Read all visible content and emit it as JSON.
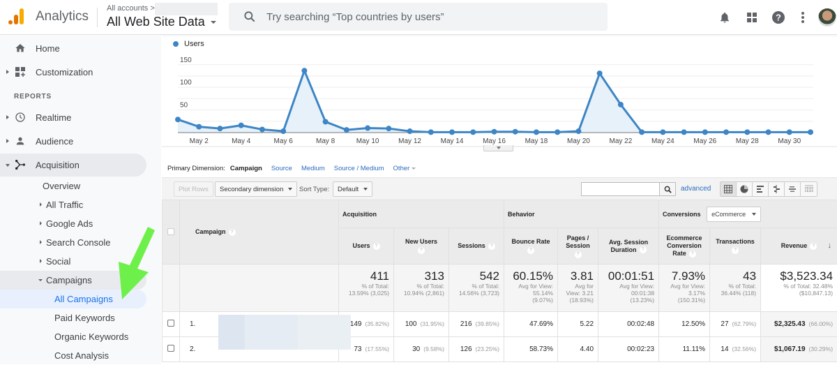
{
  "header": {
    "app_name": "Analytics",
    "account_crumb": "All accounts >",
    "view_name": "All Web Site Data",
    "search_placeholder": "Try searching “Top countries by users”",
    "icons": [
      "notifications-icon",
      "apps-grid-icon",
      "help-icon",
      "more-vert-icon",
      "avatar"
    ]
  },
  "sidebar": {
    "items": [
      {
        "label": "Home",
        "icon": "home-icon"
      },
      {
        "label": "Customization",
        "icon": "customization-icon"
      }
    ],
    "section_label": "REPORTS",
    "reports": [
      {
        "label": "Realtime",
        "icon": "clock-icon"
      },
      {
        "label": "Audience",
        "icon": "person-icon"
      },
      {
        "label": "Acquisition",
        "icon": "acquisition-icon"
      }
    ],
    "acquisition_children": [
      "Overview",
      "All Traffic",
      "Google Ads",
      "Search Console",
      "Social",
      "Campaigns"
    ],
    "campaign_children": [
      "All Campaigns",
      "Paid Keywords",
      "Organic Keywords",
      "Cost Analysis"
    ],
    "selected": "All Campaigns"
  },
  "chart_data": {
    "type": "line",
    "title": "",
    "legend": [
      "Users"
    ],
    "legend_placement": "top-left",
    "series_color": "#3d85c6",
    "x": [
      "May 1",
      "May 2",
      "May 3",
      "May 4",
      "May 5",
      "May 6",
      "May 7",
      "May 8",
      "May 9",
      "May 10",
      "May 11",
      "May 12",
      "May 13",
      "May 14",
      "May 15",
      "May 16",
      "May 17",
      "May 18",
      "May 19",
      "May 20",
      "May 21",
      "May 22",
      "May 23",
      "May 24",
      "May 25",
      "May 26",
      "May 27",
      "May 28",
      "May 29",
      "May 30",
      "May 31"
    ],
    "x_tick_labels": [
      "May 2",
      "May 4",
      "May 6",
      "May 8",
      "May 10",
      "May 12",
      "May 14",
      "May 16",
      "May 18",
      "May 20",
      "May 22",
      "May 24",
      "May 26",
      "May 28",
      "May 30"
    ],
    "series": [
      {
        "name": "Users",
        "values": [
          29,
          13,
          9,
          16,
          7,
          3,
          137,
          24,
          6,
          10,
          9,
          3,
          1,
          1,
          1,
          2,
          2,
          1,
          1,
          3,
          131,
          62,
          1,
          1,
          1,
          1,
          1,
          1,
          1,
          1,
          1
        ]
      }
    ],
    "y_ticks": [
      50,
      100,
      150
    ],
    "ylim": [
      0,
      150
    ],
    "grid": true,
    "area_fill": true
  },
  "dimension": {
    "label": "Primary Dimension:",
    "current": "Campaign",
    "links": [
      "Source",
      "Medium",
      "Source / Medium",
      "Other"
    ]
  },
  "toolbar": {
    "plot_rows": "Plot Rows",
    "secondary_dimension": "Secondary dimension",
    "sort_type_label": "Sort Type:",
    "sort_type_value": "Default",
    "search_value": "",
    "advanced": "advanced",
    "view_buttons": [
      "data-table-icon",
      "pie-chart-icon",
      "performance-bar-icon",
      "comparison-icon",
      "term-cloud-icon",
      "pivot-icon"
    ]
  },
  "table": {
    "groups": {
      "acquisition": "Acquisition",
      "behavior": "Behavior",
      "conversions": "Conversions",
      "conversions_select": "eCommerce"
    },
    "columns": {
      "campaign": "Campaign",
      "users": "Users",
      "new_users": "New Users",
      "sessions": "Sessions",
      "bounce_rate": "Bounce Rate",
      "pages_session": "Pages / Session",
      "avg_duration": "Avg. Session Duration",
      "conv_rate": "Ecommerce Conversion Rate",
      "transactions": "Transactions",
      "revenue": "Revenue"
    },
    "totals": {
      "users": {
        "value": "411",
        "sub1": "% of Total:",
        "sub2": "13.59% (3,025)"
      },
      "new_users": {
        "value": "313",
        "sub1": "% of Total:",
        "sub2": "10.94% (2,861)"
      },
      "sessions": {
        "value": "542",
        "sub1": "% of Total:",
        "sub2": "14.56% (3,723)"
      },
      "bounce_rate": {
        "value": "60.15%",
        "sub1": "Avg for View:",
        "sub2": "55.14%",
        "sub3": "(9.07%)"
      },
      "pages_session": {
        "value": "3.81",
        "sub1": "Avg for",
        "sub2": "View: 3.21",
        "sub3": "(18.93%)"
      },
      "avg_duration": {
        "value": "00:01:51",
        "sub1": "Avg for View:",
        "sub2": "00:01:38",
        "sub3": "(13.23%)"
      },
      "conv_rate": {
        "value": "7.93%",
        "sub1": "Avg for View:",
        "sub2": "3.17%",
        "sub3": "(150.31%)"
      },
      "transactions": {
        "value": "43",
        "sub1": "% of Total:",
        "sub2": "36.44% (118)"
      },
      "revenue": {
        "value": "$3,523.34",
        "sub1": "% of Total: 32.48%",
        "sub2": "($10,847.13)"
      }
    },
    "rows": [
      {
        "index": "1.",
        "users": "149",
        "users_pct": "(35.82%)",
        "new_users": "100",
        "new_users_pct": "(31.95%)",
        "sessions": "216",
        "sessions_pct": "(39.85%)",
        "bounce_rate": "47.69%",
        "pages_session": "5.22",
        "avg_duration": "00:02:48",
        "conv_rate": "12.50%",
        "transactions": "27",
        "transactions_pct": "(62.79%)",
        "revenue": "$2,325.43",
        "revenue_pct": "(66.00%)"
      },
      {
        "index": "2.",
        "users": "73",
        "users_pct": "(17.55%)",
        "new_users": "30",
        "new_users_pct": "(9.58%)",
        "sessions": "126",
        "sessions_pct": "(23.25%)",
        "bounce_rate": "58.73%",
        "pages_session": "4.40",
        "avg_duration": "00:02:23",
        "conv_rate": "11.11%",
        "transactions": "14",
        "transactions_pct": "(32.56%)",
        "revenue": "$1,067.19",
        "revenue_pct": "(30.29%)"
      }
    ]
  },
  "annotation": {
    "arrow_color": "#6ef04a"
  }
}
